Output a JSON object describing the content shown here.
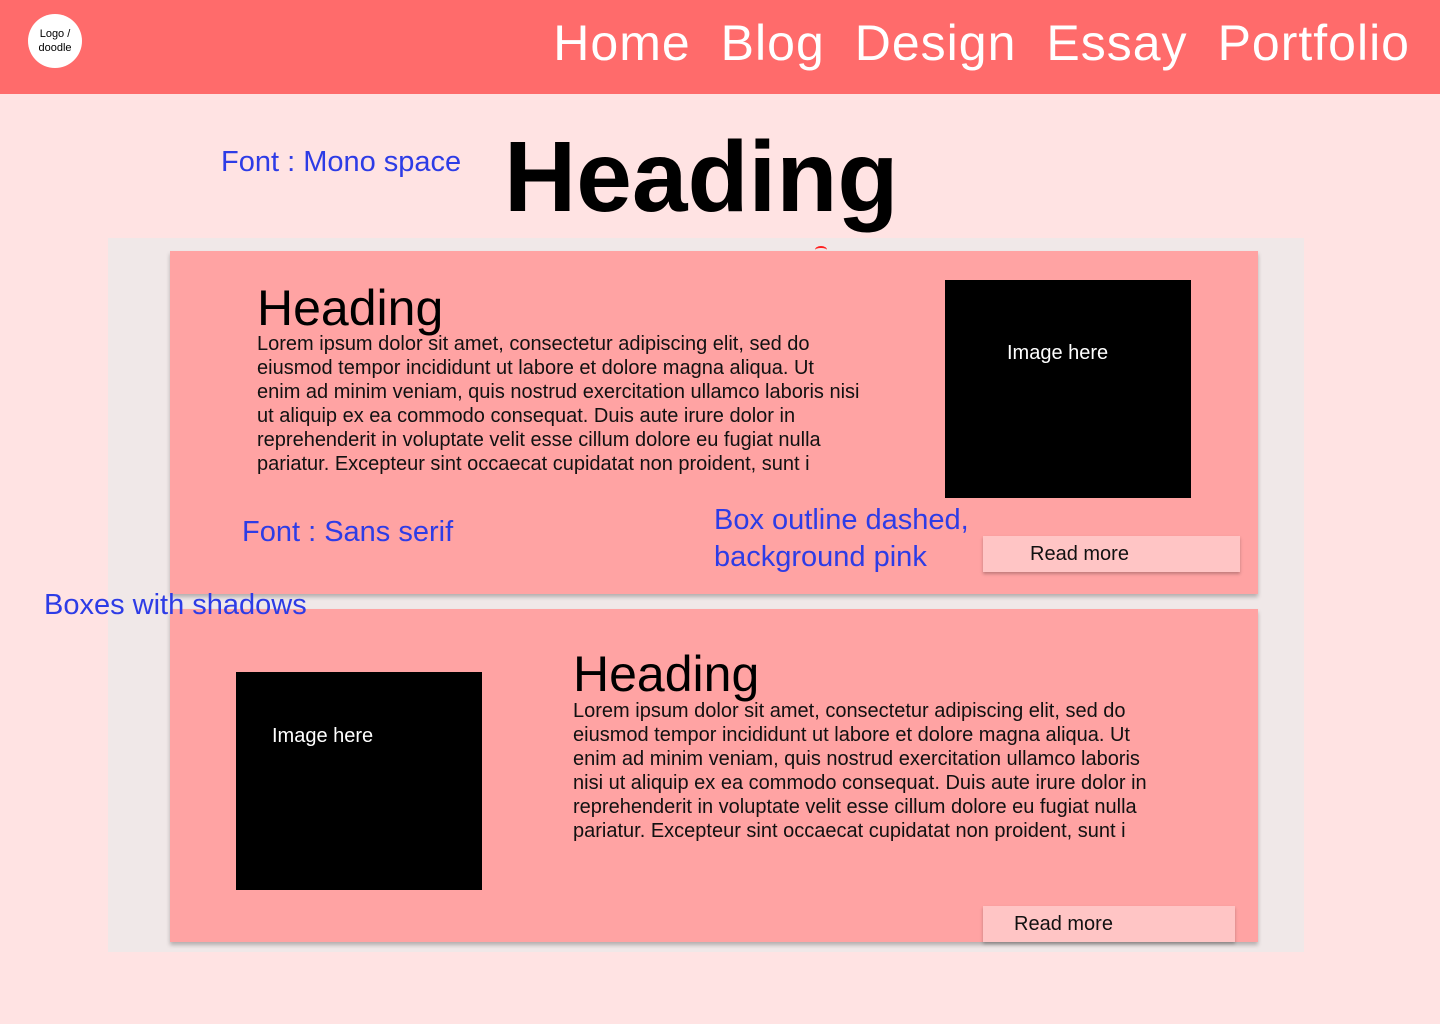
{
  "header": {
    "logo_text": "Logo / doodle",
    "nav": [
      "Home",
      "Blog",
      "Design",
      "Essay",
      "Portfolio"
    ]
  },
  "main_heading": "Heading",
  "annotations": {
    "font_mono": "Font : Mono space",
    "font_sans": "Font : Sans serif",
    "box_outline_line1": "Box outline dashed,",
    "box_outline_line2": "background pink",
    "boxes_shadows": "Boxes with shadows"
  },
  "cards": [
    {
      "heading": "Heading",
      "body": "Lorem ipsum dolor sit amet, consectetur adipiscing elit, sed do eiusmod tempor incididunt ut labore et dolore magna aliqua. Ut enim ad minim veniam, quis nostrud exercitation ullamco laboris nisi ut aliquip ex ea commodo consequat. Duis aute irure dolor in reprehenderit in voluptate velit esse cillum dolore eu fugiat nulla pariatur. Excepteur sint occaecat cupidatat non proident, sunt i",
      "image_label": "Image here",
      "button": "Read more"
    },
    {
      "heading": "Heading",
      "body": "Lorem ipsum dolor sit amet, consectetur adipiscing elit, sed do eiusmod tempor incididunt ut labore et dolore magna aliqua. Ut enim ad minim veniam, quis nostrud exercitation ullamco laboris nisi ut aliquip ex ea commodo consequat. Duis aute irure dolor in reprehenderit in voluptate velit esse cillum dolore eu fugiat nulla pariatur. Excepteur sint occaecat cupidatat non proident, sunt i",
      "image_label": "Image here",
      "button": "Read more"
    }
  ],
  "colors": {
    "header_bg": "#ff6b6b",
    "page_bg": "#ffe3e3",
    "panel_bg": "#f0e8e8",
    "card_bg": "#ffa3a3",
    "button_bg": "#ffc5c5",
    "annotation": "#2d3ce6"
  }
}
